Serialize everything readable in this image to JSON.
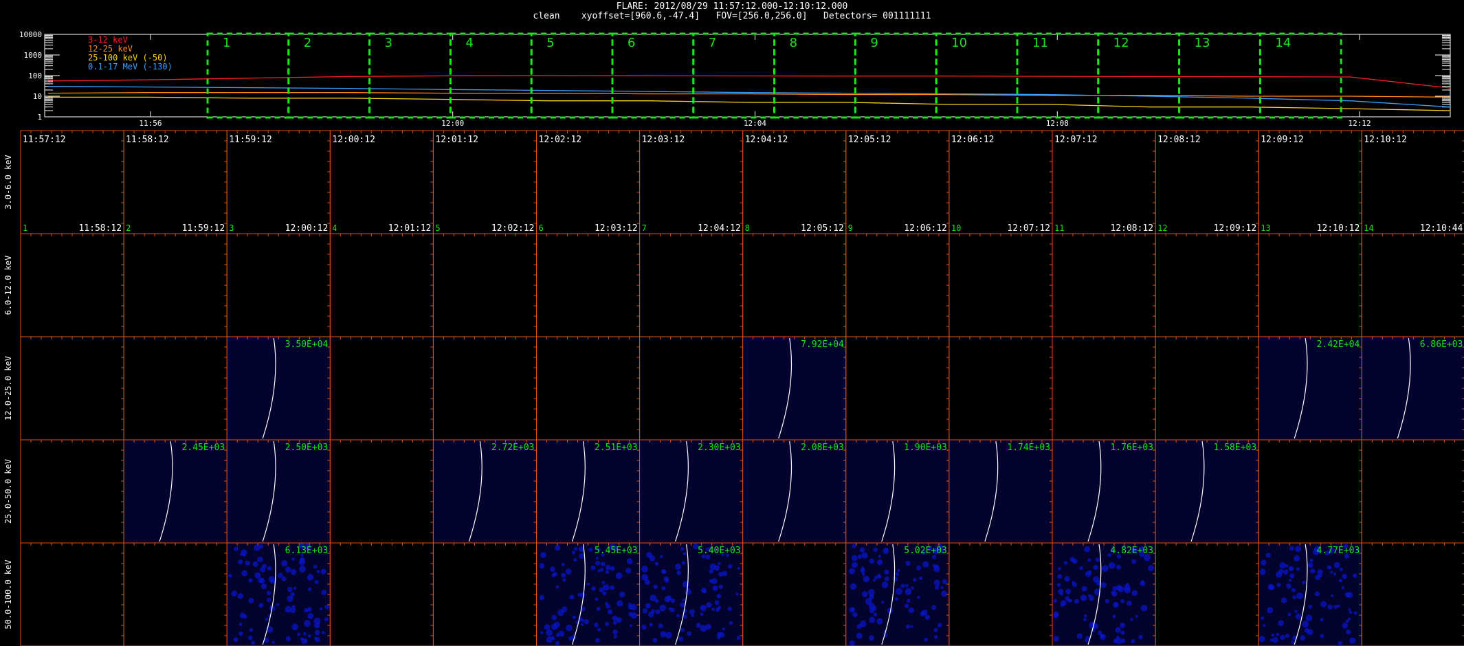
{
  "header": {
    "line1": "FLARE: 2012/08/29 11:57:12.000-12:10:12.000",
    "line2": "clean    xyoffset=[960.6,-47.4]   FOV=[256.0,256.0]   Detectors= 001111111"
  },
  "chart_data": [
    {
      "type": "line",
      "ylog": true,
      "yticks": [
        "10000",
        "1000",
        "100",
        "10",
        "1"
      ],
      "xticks": [
        "11:56",
        "12:00",
        "12:04",
        "12:08",
        "12:12"
      ],
      "legend": [
        {
          "label": "3-12 keV",
          "color": "#ff2020"
        },
        {
          "label": "12-25 keV",
          "color": "#ff8a1e"
        },
        {
          "label": "25-100 keV (-50)",
          "color": "#ffd11a"
        },
        {
          "label": "0.1-17 MeV (-130)",
          "color": "#3aa0ff"
        }
      ],
      "intervals": [
        "1",
        "2",
        "3",
        "4",
        "5",
        "6",
        "7",
        "8",
        "9",
        "10",
        "11",
        "12",
        "13",
        "14"
      ],
      "series": [
        {
          "name": "3-12 keV",
          "color": "#ff2020",
          "x": [
            11.9,
            12.0,
            12.1,
            12.2,
            12.3,
            12.4,
            12.5,
            12.6,
            12.7,
            12.8,
            12.9,
            13.0,
            13.1,
            13.2,
            13.3
          ],
          "y": [
            55,
            62,
            75,
            90,
            98,
            100,
            98,
            96,
            95,
            95,
            92,
            90,
            88,
            86,
            25
          ]
        },
        {
          "name": "12-25 keV",
          "color": "#ff8a1e",
          "x": [
            11.9,
            12.0,
            12.1,
            12.2,
            12.3,
            12.4,
            12.5,
            12.6,
            12.7,
            12.8,
            12.9,
            13.0,
            13.1,
            13.2,
            13.3
          ],
          "y": [
            14,
            15,
            15,
            15,
            14,
            14,
            13,
            13,
            12,
            12,
            11,
            11,
            10,
            10,
            9
          ]
        },
        {
          "name": "25-100 keV (-50)",
          "color": "#ffd11a",
          "x": [
            11.9,
            12.0,
            12.1,
            12.2,
            12.3,
            12.4,
            12.5,
            12.6,
            12.7,
            12.8,
            12.9,
            13.0,
            13.1,
            13.2,
            13.3
          ],
          "y": [
            9,
            9,
            8,
            8,
            7,
            6,
            6,
            5,
            5,
            4,
            4,
            3,
            3,
            2.5,
            2
          ]
        },
        {
          "name": "0.1-17 MeV (-130)",
          "color": "#3aa0ff",
          "x": [
            11.9,
            12.0,
            12.1,
            12.2,
            12.3,
            12.4,
            12.5,
            12.6,
            12.7,
            12.8,
            12.9,
            13.0,
            13.1,
            13.2,
            13.3
          ],
          "y": [
            30,
            28,
            26,
            24,
            21,
            19,
            17,
            15,
            14,
            13,
            12,
            10,
            8,
            6,
            3
          ]
        }
      ]
    },
    {
      "type": "heatmap",
      "row_labels": [
        "3.0-6.0 keV",
        "6.0-12.0 keV",
        "12.0-25.0 keV",
        "25.0-50.0 keV",
        "50.0-100.0 keV"
      ],
      "column_times": [
        "11:57:12",
        "11:58:12",
        "11:59:12",
        "12:00:12",
        "12:01:12",
        "12:02:12",
        "12:03:12",
        "12:04:12",
        "12:05:12",
        "12:06:12",
        "12:07:12",
        "12:08:12",
        "12:09:12",
        "12:10:12"
      ],
      "column_end_times": [
        "11:58:12",
        "11:59:12",
        "12:00:12",
        "12:01:12",
        "12:02:12",
        "12:03:12",
        "12:04:12",
        "12:05:12",
        "12:06:12",
        "12:07:12",
        "12:08:12",
        "12:09:12",
        "12:10:12",
        "12:10:44"
      ],
      "column_numbers": [
        "1",
        "2",
        "3",
        "4",
        "5",
        "6",
        "7",
        "8",
        "9",
        "10",
        "11",
        "12",
        "13",
        "14"
      ],
      "images": [
        {
          "row": 2,
          "col": 2,
          "value": "3.50E+04"
        },
        {
          "row": 2,
          "col": 7,
          "value": "7.92E+04"
        },
        {
          "row": 2,
          "col": 12,
          "value": "2.42E+04"
        },
        {
          "row": 2,
          "col": 13,
          "value": "6.86E+03"
        },
        {
          "row": 3,
          "col": 1,
          "value": "2.45E+03"
        },
        {
          "row": 3,
          "col": 2,
          "value": "2.50E+03"
        },
        {
          "row": 3,
          "col": 4,
          "value": "2.72E+03"
        },
        {
          "row": 3,
          "col": 5,
          "value": "2.51E+03"
        },
        {
          "row": 3,
          "col": 6,
          "value": "2.30E+03"
        },
        {
          "row": 3,
          "col": 7,
          "value": "2.08E+03"
        },
        {
          "row": 3,
          "col": 8,
          "value": "1.90E+03"
        },
        {
          "row": 3,
          "col": 9,
          "value": "1.74E+03"
        },
        {
          "row": 3,
          "col": 10,
          "value": "1.76E+03"
        },
        {
          "row": 3,
          "col": 11,
          "value": "1.58E+03"
        },
        {
          "row": 4,
          "col": 2,
          "value": "6.13E+03",
          "noisy": true
        },
        {
          "row": 4,
          "col": 5,
          "value": "5.45E+03",
          "noisy": true
        },
        {
          "row": 4,
          "col": 6,
          "value": "5.40E+03",
          "noisy": true
        },
        {
          "row": 4,
          "col": 8,
          "value": "5.02E+03",
          "noisy": true
        },
        {
          "row": 4,
          "col": 10,
          "value": "4.82E+03",
          "noisy": true
        },
        {
          "row": 4,
          "col": 12,
          "value": "4.77E+03",
          "noisy": true
        }
      ]
    }
  ]
}
